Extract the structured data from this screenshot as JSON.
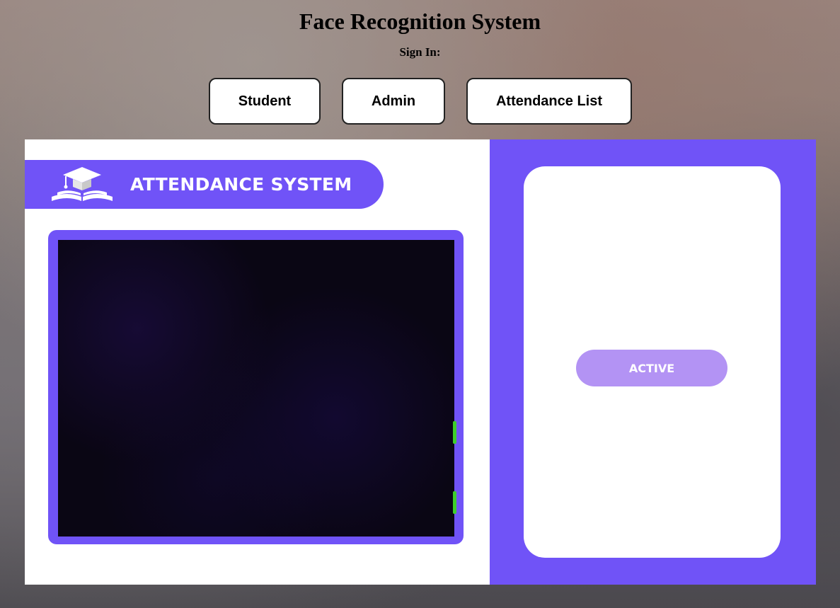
{
  "header": {
    "title": "Face Recognition System",
    "sign_in_label": "Sign In:"
  },
  "nav": {
    "student_label": "Student",
    "admin_label": "Admin",
    "attendance_list_label": "Attendance List"
  },
  "attendance_panel": {
    "brand_title": "ATTENDANCE SYSTEM",
    "logo_icon": "graduation-cap-book-icon",
    "camera_feed": "live-camera-feed"
  },
  "status_panel": {
    "status_label": "ACTIVE"
  },
  "colors": {
    "accent": "#7053f7",
    "status_button": "#b393f4",
    "indicator": "#3ecf2a"
  }
}
